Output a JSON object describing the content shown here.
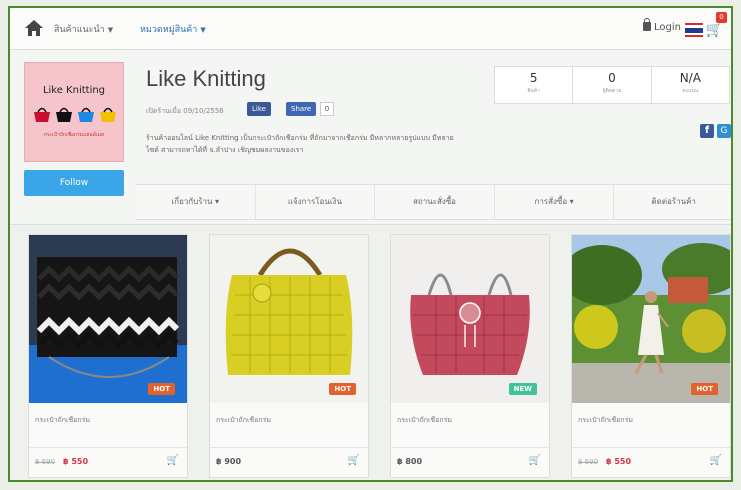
{
  "nav": {
    "home_icon": "home-icon",
    "items": [
      {
        "label": "สินค้าแนะนำ",
        "active": false
      },
      {
        "label": "หมวดหมู่สินค้า",
        "active": true
      }
    ],
    "login_label": "Login",
    "cart_count": "0"
  },
  "shop": {
    "logo_title": "Like  Knitting",
    "logo_subtitle": "กระเป๋าถักเชือกร่มแฮนด์เมด",
    "follow_label": "Follow",
    "name": "Like Knitting",
    "since": "เปิดร้านเมื่อ 09/10/2556",
    "fb_like_label": "Like",
    "fb_share_label": "Share",
    "fb_count": "0",
    "description": "ร้านค้าออนไลน์ Like Knitting เป็นกระเป๋าถักเชือกร่ม ที่ถักมาจากเชือกร่ม มีหลากหลายรูปแบบ มีหลายไซด์ สามารถหาได้ที่ จ.ลำปาง เชิญชมผลงานของเรา",
    "stats": [
      {
        "value": "5",
        "label": "สินค้า"
      },
      {
        "value": "0",
        "label": "ผู้ติดตาม"
      },
      {
        "value": "N/A",
        "label": "คะแนน"
      }
    ]
  },
  "tabs": [
    {
      "label": "เกี่ยวกับร้าน ▾"
    },
    {
      "label": "แจ้งการโอนเงิน"
    },
    {
      "label": "สถานะสั่งซื้อ"
    },
    {
      "label": "การสั่งซื้อ ▾"
    },
    {
      "label": "ติดต่อร้านค้า"
    }
  ],
  "products": [
    {
      "name": "กระเป๋าถักเชือกร่ม",
      "badge": "HOT",
      "old_price": "฿ 690",
      "price": "฿ 550",
      "price_style": "red"
    },
    {
      "name": "กระเป๋าถักเชือกร่ม",
      "badge": "HOT",
      "old_price": "",
      "price": "฿ 900",
      "price_style": "gray"
    },
    {
      "name": "กระเป๋าถักเชือกร่ม",
      "badge": "NEW",
      "old_price": "",
      "price": "฿ 800",
      "price_style": "gray"
    },
    {
      "name": "กระเป๋าถักเชือกร่ม",
      "badge": "HOT",
      "old_price": "฿ 690",
      "price": "฿ 550",
      "price_style": "red"
    }
  ],
  "colors": {
    "accent": "#2e6fb5",
    "follow": "#3aa6e8",
    "hot_badge": "#e2622d",
    "new_badge": "#3fc39b",
    "sale_price": "#d3344a"
  }
}
